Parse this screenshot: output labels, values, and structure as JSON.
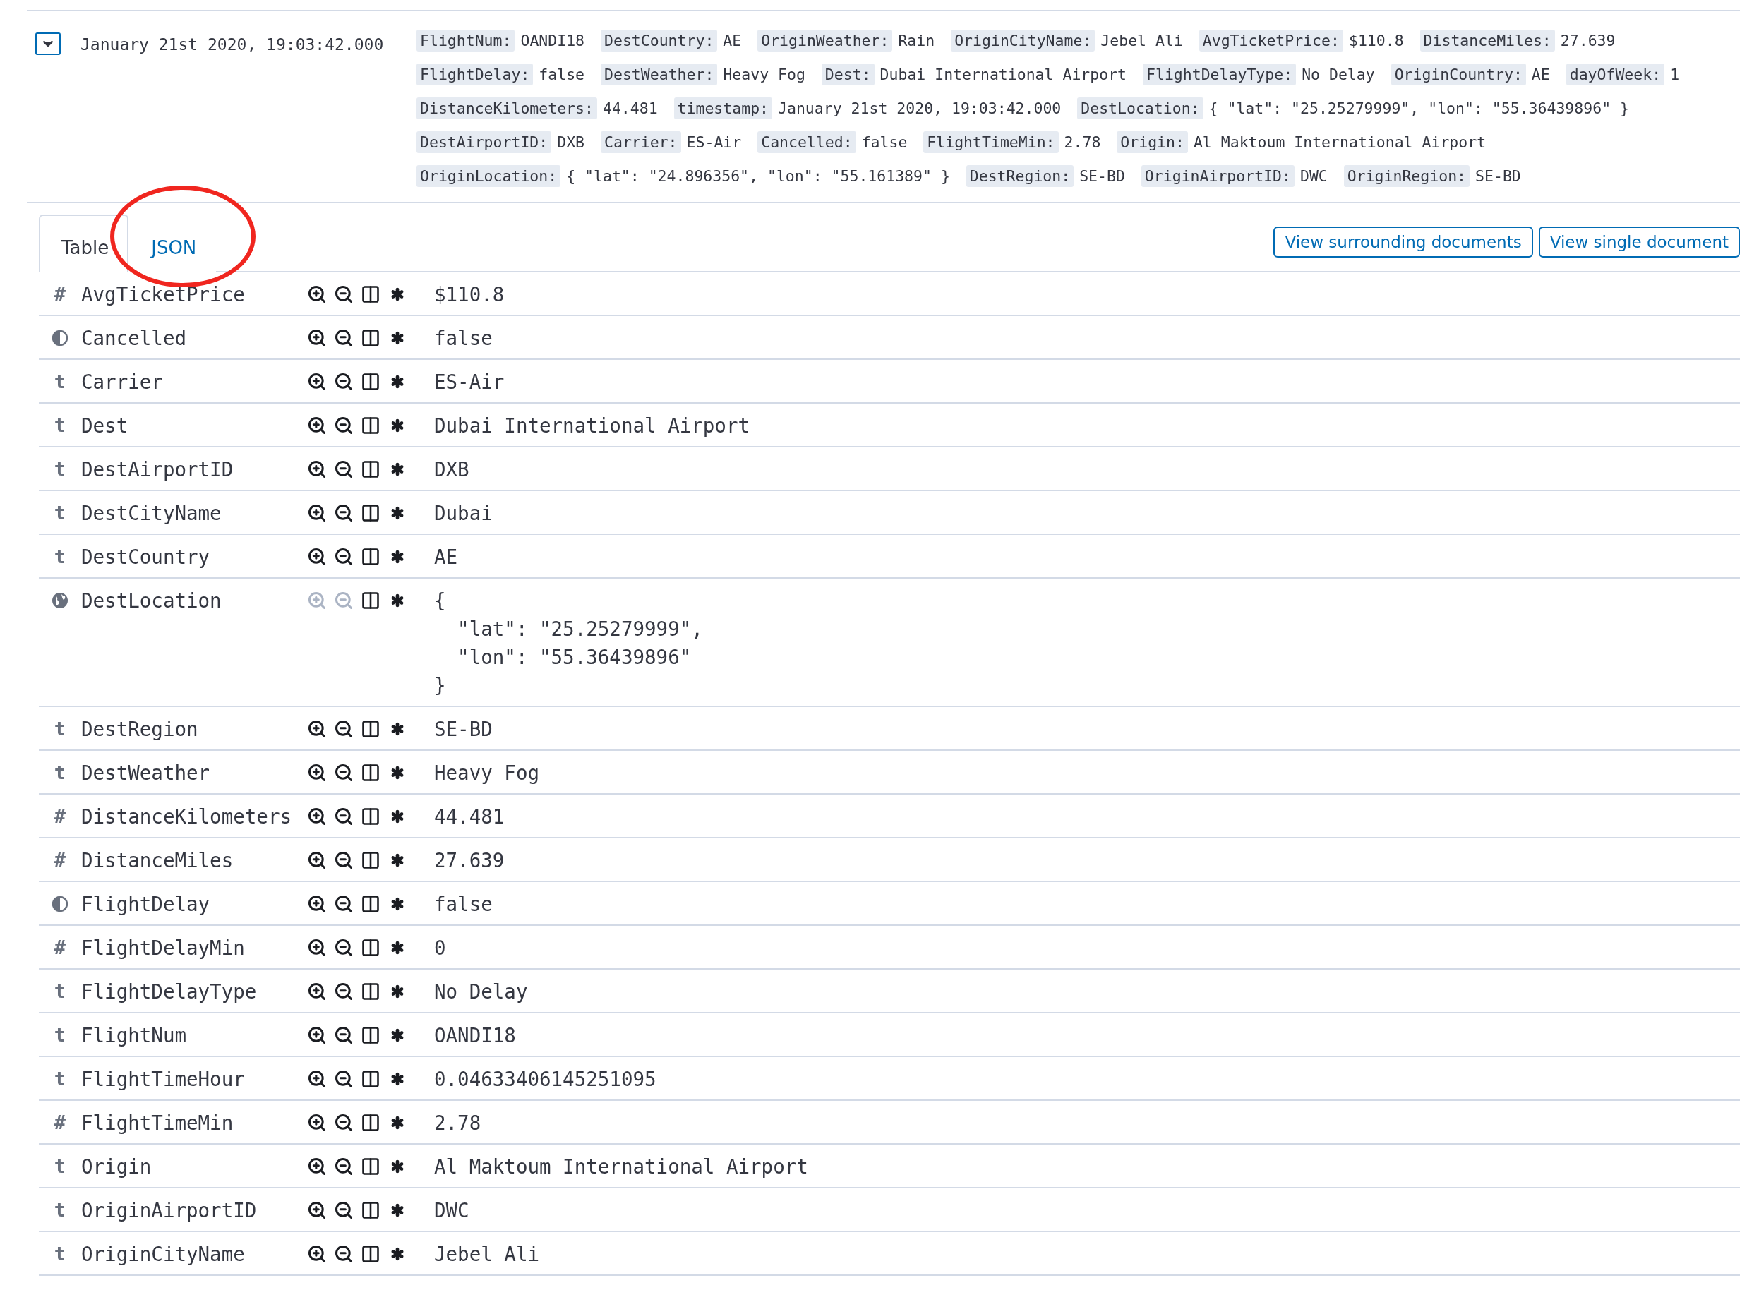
{
  "document": {
    "expanded": true,
    "timestamp": "January 21st 2020, 19:03:42.000",
    "summary": [
      {
        "label": "FlightNum:",
        "value": "OANDI18"
      },
      {
        "label": "DestCountry:",
        "value": "AE"
      },
      {
        "label": "OriginWeather:",
        "value": "Rain"
      },
      {
        "label": "OriginCityName:",
        "value": "Jebel Ali"
      },
      {
        "label": "AvgTicketPrice:",
        "value": "$110.8"
      },
      {
        "label": "DistanceMiles:",
        "value": "27.639"
      },
      {
        "label": "FlightDelay:",
        "value": "false"
      },
      {
        "label": "DestWeather:",
        "value": "Heavy Fog"
      },
      {
        "label": "Dest:",
        "value": "Dubai International Airport"
      },
      {
        "label": "FlightDelayType:",
        "value": "No Delay"
      },
      {
        "label": "OriginCountry:",
        "value": "AE"
      },
      {
        "label": "dayOfWeek:",
        "value": "1"
      },
      {
        "label": "DistanceKilometers:",
        "value": "44.481"
      },
      {
        "label": "timestamp:",
        "value": "January 21st 2020, 19:03:42.000"
      },
      {
        "label": "DestLocation:",
        "value": "{ \"lat\": \"25.25279999\", \"lon\": \"55.36439896\" }"
      },
      {
        "label": "DestAirportID:",
        "value": "DXB"
      },
      {
        "label": "Carrier:",
        "value": "ES-Air"
      },
      {
        "label": "Cancelled:",
        "value": "false"
      },
      {
        "label": "FlightTimeMin:",
        "value": "2.78"
      },
      {
        "label": "Origin:",
        "value": "Al Maktoum International Airport"
      },
      {
        "label": "OriginLocation:",
        "value": "{ \"lat\": \"24.896356\", \"lon\": \"55.161389\" }"
      },
      {
        "label": "DestRegion:",
        "value": "SE-BD"
      },
      {
        "label": "OriginAirportID:",
        "value": "DWC"
      },
      {
        "label": "OriginRegion:",
        "value": "SE-BD"
      }
    ]
  },
  "tabs": [
    {
      "label": "Table",
      "selected": true
    },
    {
      "label": "JSON",
      "selected": false
    }
  ],
  "buttons": [
    "View surrounding documents",
    "View single document"
  ],
  "fields": [
    {
      "kind": "number",
      "symbol": "#",
      "name": "AvgTicketPrice",
      "value": "$110.8",
      "filterable": true
    },
    {
      "kind": "boolean",
      "name": "Cancelled",
      "value": "false",
      "filterable": true
    },
    {
      "kind": "string",
      "symbol": "t",
      "name": "Carrier",
      "value": "ES-Air",
      "filterable": true
    },
    {
      "kind": "string",
      "symbol": "t",
      "name": "Dest",
      "value": "Dubai International Airport",
      "filterable": true
    },
    {
      "kind": "string",
      "symbol": "t",
      "name": "DestAirportID",
      "value": "DXB",
      "filterable": true
    },
    {
      "kind": "string",
      "symbol": "t",
      "name": "DestCityName",
      "value": "Dubai",
      "filterable": true
    },
    {
      "kind": "string",
      "symbol": "t",
      "name": "DestCountry",
      "value": "AE",
      "filterable": true
    },
    {
      "kind": "geo",
      "name": "DestLocation",
      "value": "{\n  \"lat\": \"25.25279999\",\n  \"lon\": \"55.36439896\"\n}",
      "filterable": false
    },
    {
      "kind": "string",
      "symbol": "t",
      "name": "DestRegion",
      "value": "SE-BD",
      "filterable": true
    },
    {
      "kind": "string",
      "symbol": "t",
      "name": "DestWeather",
      "value": "Heavy Fog",
      "filterable": true
    },
    {
      "kind": "number",
      "symbol": "#",
      "name": "DistanceKilometers",
      "value": "44.481",
      "filterable": true
    },
    {
      "kind": "number",
      "symbol": "#",
      "name": "DistanceMiles",
      "value": "27.639",
      "filterable": true
    },
    {
      "kind": "boolean",
      "name": "FlightDelay",
      "value": "false",
      "filterable": true
    },
    {
      "kind": "number",
      "symbol": "#",
      "name": "FlightDelayMin",
      "value": "0",
      "filterable": true
    },
    {
      "kind": "string",
      "symbol": "t",
      "name": "FlightDelayType",
      "value": "No Delay",
      "filterable": true
    },
    {
      "kind": "string",
      "symbol": "t",
      "name": "FlightNum",
      "value": "OANDI18",
      "filterable": true
    },
    {
      "kind": "string",
      "symbol": "t",
      "name": "FlightTimeHour",
      "value": "0.04633406145251095",
      "filterable": true
    },
    {
      "kind": "number",
      "symbol": "#",
      "name": "FlightTimeMin",
      "value": "2.78",
      "filterable": true
    },
    {
      "kind": "string",
      "symbol": "t",
      "name": "Origin",
      "value": "Al Maktoum International Airport",
      "filterable": true
    },
    {
      "kind": "string",
      "symbol": "t",
      "name": "OriginAirportID",
      "value": "DWC",
      "filterable": true
    },
    {
      "kind": "string",
      "symbol": "t",
      "name": "OriginCityName",
      "value": "Jebel Ali",
      "filterable": true
    }
  ]
}
